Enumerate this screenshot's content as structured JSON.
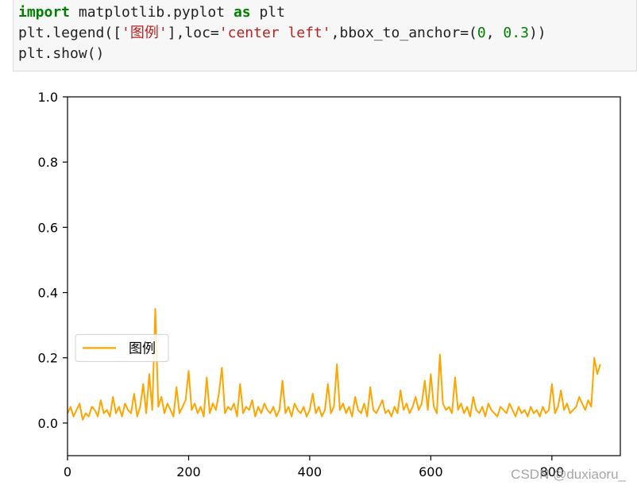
{
  "code": {
    "line1": {
      "kw1": "import",
      "mid": " matplotlib.pyplot ",
      "kw2": "as",
      "end": " plt"
    },
    "line2": {
      "p1": "plt.legend([",
      "s1": "'图例'",
      "p2": "],loc=",
      "s2": "'center left'",
      "p3": ",bbox_to_anchor=(",
      "n1": "0",
      "p4": ", ",
      "n2": "0.3",
      "p5": "))"
    },
    "line3": "plt.show()"
  },
  "watermark": "CSDN @duxiaoru_",
  "chart_data": {
    "type": "line",
    "title": "",
    "xlabel": "",
    "ylabel": "",
    "xlim": [
      0,
      913
    ],
    "ylim": [
      -0.1,
      1.0
    ],
    "xticks": [
      0,
      200,
      400,
      600,
      800
    ],
    "yticks": [
      0.0,
      0.2,
      0.4,
      0.6,
      0.8,
      1.0
    ],
    "ytick_labels": [
      "0.0",
      "0.2",
      "0.4",
      "0.6",
      "0.8",
      "1.0"
    ],
    "legend": {
      "placement": "center-left",
      "entries": [
        "图例"
      ]
    },
    "series": [
      {
        "name": "图例",
        "color": "#ffa500",
        "x_start": 0,
        "x_step": 5,
        "values": [
          0.03,
          0.05,
          0.02,
          0.04,
          0.06,
          0.01,
          0.03,
          0.02,
          0.05,
          0.04,
          0.02,
          0.07,
          0.03,
          0.04,
          0.02,
          0.08,
          0.03,
          0.05,
          0.02,
          0.06,
          0.04,
          0.03,
          0.09,
          0.02,
          0.05,
          0.12,
          0.03,
          0.15,
          0.04,
          0.35,
          0.05,
          0.08,
          0.03,
          0.06,
          0.04,
          0.02,
          0.11,
          0.03,
          0.05,
          0.07,
          0.16,
          0.04,
          0.06,
          0.03,
          0.05,
          0.02,
          0.14,
          0.03,
          0.06,
          0.04,
          0.09,
          0.17,
          0.03,
          0.05,
          0.04,
          0.06,
          0.02,
          0.12,
          0.03,
          0.05,
          0.04,
          0.07,
          0.02,
          0.05,
          0.03,
          0.06,
          0.04,
          0.03,
          0.05,
          0.02,
          0.04,
          0.13,
          0.03,
          0.05,
          0.02,
          0.06,
          0.04,
          0.03,
          0.05,
          0.02,
          0.04,
          0.09,
          0.03,
          0.05,
          0.02,
          0.04,
          0.12,
          0.03,
          0.05,
          0.18,
          0.04,
          0.06,
          0.03,
          0.05,
          0.02,
          0.08,
          0.04,
          0.03,
          0.06,
          0.02,
          0.11,
          0.04,
          0.03,
          0.05,
          0.07,
          0.03,
          0.04,
          0.02,
          0.05,
          0.03,
          0.1,
          0.04,
          0.06,
          0.03,
          0.05,
          0.08,
          0.04,
          0.06,
          0.13,
          0.04,
          0.15,
          0.05,
          0.03,
          0.21,
          0.06,
          0.04,
          0.05,
          0.03,
          0.14,
          0.04,
          0.06,
          0.03,
          0.05,
          0.02,
          0.08,
          0.04,
          0.03,
          0.05,
          0.02,
          0.06,
          0.04,
          0.03,
          0.02,
          0.05,
          0.04,
          0.03,
          0.06,
          0.04,
          0.02,
          0.05,
          0.03,
          0.04,
          0.02,
          0.05,
          0.03,
          0.04,
          0.02,
          0.05,
          0.03,
          0.04,
          0.12,
          0.03,
          0.05,
          0.1,
          0.04,
          0.06,
          0.03,
          0.04,
          0.05,
          0.08,
          0.06,
          0.04,
          0.07,
          0.05,
          0.2,
          0.15,
          0.18
        ]
      }
    ]
  }
}
